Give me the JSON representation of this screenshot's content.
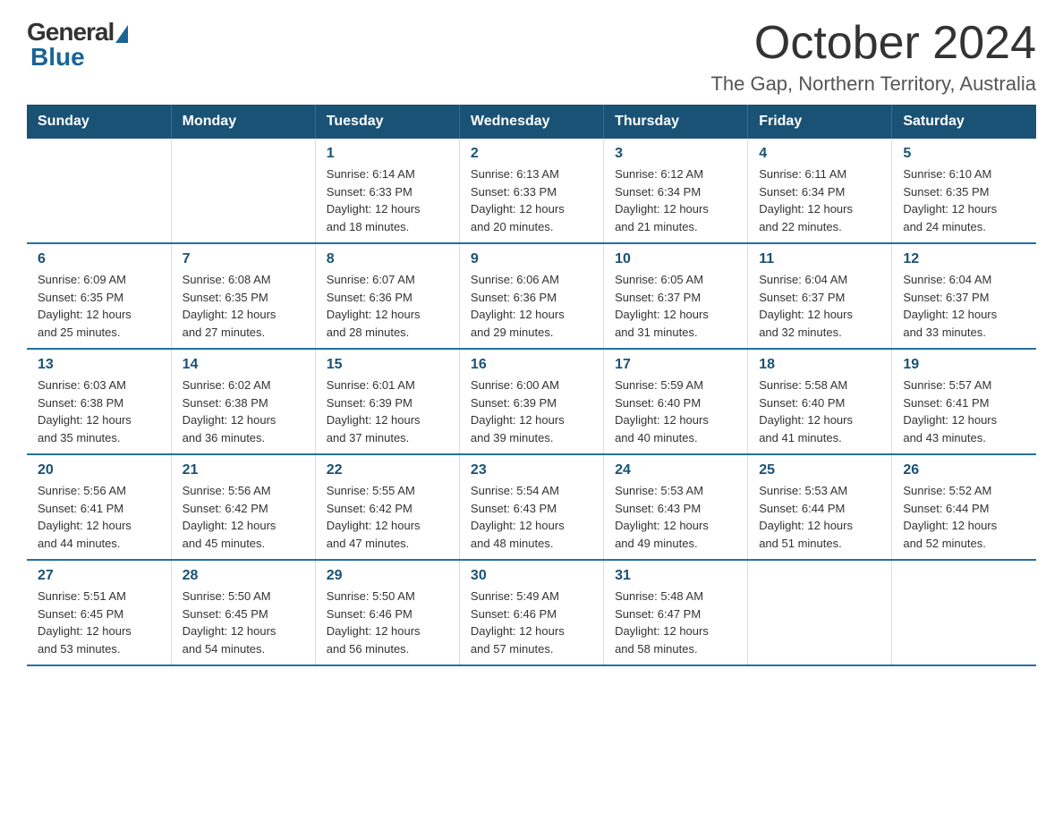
{
  "logo": {
    "general": "General",
    "blue": "Blue"
  },
  "title": "October 2024",
  "subtitle": "The Gap, Northern Territory, Australia",
  "days_header": [
    "Sunday",
    "Monday",
    "Tuesday",
    "Wednesday",
    "Thursday",
    "Friday",
    "Saturday"
  ],
  "weeks": [
    [
      {
        "day": "",
        "info": ""
      },
      {
        "day": "",
        "info": ""
      },
      {
        "day": "1",
        "info": "Sunrise: 6:14 AM\nSunset: 6:33 PM\nDaylight: 12 hours\nand 18 minutes."
      },
      {
        "day": "2",
        "info": "Sunrise: 6:13 AM\nSunset: 6:33 PM\nDaylight: 12 hours\nand 20 minutes."
      },
      {
        "day": "3",
        "info": "Sunrise: 6:12 AM\nSunset: 6:34 PM\nDaylight: 12 hours\nand 21 minutes."
      },
      {
        "day": "4",
        "info": "Sunrise: 6:11 AM\nSunset: 6:34 PM\nDaylight: 12 hours\nand 22 minutes."
      },
      {
        "day": "5",
        "info": "Sunrise: 6:10 AM\nSunset: 6:35 PM\nDaylight: 12 hours\nand 24 minutes."
      }
    ],
    [
      {
        "day": "6",
        "info": "Sunrise: 6:09 AM\nSunset: 6:35 PM\nDaylight: 12 hours\nand 25 minutes."
      },
      {
        "day": "7",
        "info": "Sunrise: 6:08 AM\nSunset: 6:35 PM\nDaylight: 12 hours\nand 27 minutes."
      },
      {
        "day": "8",
        "info": "Sunrise: 6:07 AM\nSunset: 6:36 PM\nDaylight: 12 hours\nand 28 minutes."
      },
      {
        "day": "9",
        "info": "Sunrise: 6:06 AM\nSunset: 6:36 PM\nDaylight: 12 hours\nand 29 minutes."
      },
      {
        "day": "10",
        "info": "Sunrise: 6:05 AM\nSunset: 6:37 PM\nDaylight: 12 hours\nand 31 minutes."
      },
      {
        "day": "11",
        "info": "Sunrise: 6:04 AM\nSunset: 6:37 PM\nDaylight: 12 hours\nand 32 minutes."
      },
      {
        "day": "12",
        "info": "Sunrise: 6:04 AM\nSunset: 6:37 PM\nDaylight: 12 hours\nand 33 minutes."
      }
    ],
    [
      {
        "day": "13",
        "info": "Sunrise: 6:03 AM\nSunset: 6:38 PM\nDaylight: 12 hours\nand 35 minutes."
      },
      {
        "day": "14",
        "info": "Sunrise: 6:02 AM\nSunset: 6:38 PM\nDaylight: 12 hours\nand 36 minutes."
      },
      {
        "day": "15",
        "info": "Sunrise: 6:01 AM\nSunset: 6:39 PM\nDaylight: 12 hours\nand 37 minutes."
      },
      {
        "day": "16",
        "info": "Sunrise: 6:00 AM\nSunset: 6:39 PM\nDaylight: 12 hours\nand 39 minutes."
      },
      {
        "day": "17",
        "info": "Sunrise: 5:59 AM\nSunset: 6:40 PM\nDaylight: 12 hours\nand 40 minutes."
      },
      {
        "day": "18",
        "info": "Sunrise: 5:58 AM\nSunset: 6:40 PM\nDaylight: 12 hours\nand 41 minutes."
      },
      {
        "day": "19",
        "info": "Sunrise: 5:57 AM\nSunset: 6:41 PM\nDaylight: 12 hours\nand 43 minutes."
      }
    ],
    [
      {
        "day": "20",
        "info": "Sunrise: 5:56 AM\nSunset: 6:41 PM\nDaylight: 12 hours\nand 44 minutes."
      },
      {
        "day": "21",
        "info": "Sunrise: 5:56 AM\nSunset: 6:42 PM\nDaylight: 12 hours\nand 45 minutes."
      },
      {
        "day": "22",
        "info": "Sunrise: 5:55 AM\nSunset: 6:42 PM\nDaylight: 12 hours\nand 47 minutes."
      },
      {
        "day": "23",
        "info": "Sunrise: 5:54 AM\nSunset: 6:43 PM\nDaylight: 12 hours\nand 48 minutes."
      },
      {
        "day": "24",
        "info": "Sunrise: 5:53 AM\nSunset: 6:43 PM\nDaylight: 12 hours\nand 49 minutes."
      },
      {
        "day": "25",
        "info": "Sunrise: 5:53 AM\nSunset: 6:44 PM\nDaylight: 12 hours\nand 51 minutes."
      },
      {
        "day": "26",
        "info": "Sunrise: 5:52 AM\nSunset: 6:44 PM\nDaylight: 12 hours\nand 52 minutes."
      }
    ],
    [
      {
        "day": "27",
        "info": "Sunrise: 5:51 AM\nSunset: 6:45 PM\nDaylight: 12 hours\nand 53 minutes."
      },
      {
        "day": "28",
        "info": "Sunrise: 5:50 AM\nSunset: 6:45 PM\nDaylight: 12 hours\nand 54 minutes."
      },
      {
        "day": "29",
        "info": "Sunrise: 5:50 AM\nSunset: 6:46 PM\nDaylight: 12 hours\nand 56 minutes."
      },
      {
        "day": "30",
        "info": "Sunrise: 5:49 AM\nSunset: 6:46 PM\nDaylight: 12 hours\nand 57 minutes."
      },
      {
        "day": "31",
        "info": "Sunrise: 5:48 AM\nSunset: 6:47 PM\nDaylight: 12 hours\nand 58 minutes."
      },
      {
        "day": "",
        "info": ""
      },
      {
        "day": "",
        "info": ""
      }
    ]
  ]
}
